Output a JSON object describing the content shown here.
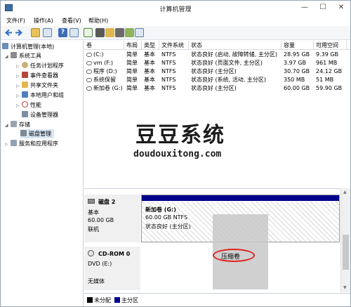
{
  "window": {
    "title": "计算机管理",
    "minimize": "—",
    "maximize": "☐",
    "close": "✕"
  },
  "menu": [
    "文件(F)",
    "操作(A)",
    "查看(V)",
    "帮助(H)"
  ],
  "tree": {
    "root": "计算机管理(本地)",
    "system_tools": "系统工具",
    "task_scheduler": "任务计划程序",
    "event_viewer": "事件查看器",
    "shared_folders": "共享文件夹",
    "local_users": "本地用户和组",
    "performance": "性能",
    "device_manager": "设备管理器",
    "storage": "存储",
    "disk_management": "磁盘管理",
    "services": "服务和应用程序"
  },
  "volumes": {
    "headers": [
      "卷",
      "布局",
      "类型",
      "文件系统",
      "状态",
      "容量",
      "可用空间"
    ],
    "rows": [
      [
        "(C:)",
        "简单",
        "基本",
        "NTFS",
        "状态良好 (启动, 故障转储, 主分区)",
        "28.95 GB",
        "9.39 GB"
      ],
      [
        "vm (F:)",
        "简单",
        "基本",
        "NTFS",
        "状态良好 (页面文件, 主分区)",
        "3.97 GB",
        "961 MB"
      ],
      [
        "程序 (D:)",
        "简单",
        "基本",
        "NTFS",
        "状态良好 (主分区)",
        "30.70 GB",
        "24.12 GB"
      ],
      [
        "系统保留",
        "简单",
        "基本",
        "NTFS",
        "状态良好 (系统, 活动, 主分区)",
        "350 MB",
        "51 MB"
      ],
      [
        "新加卷 (G:)",
        "简单",
        "基本",
        "NTFS",
        "状态良好 (主分区)",
        "60.00 GB",
        "59.90 GB"
      ]
    ]
  },
  "watermark": {
    "title": "豆豆系统",
    "url": "doudouxitong.com"
  },
  "disk2": {
    "name": "磁盘 2",
    "type": "基本",
    "size": "60.00 GB",
    "status": "联机"
  },
  "partition": {
    "name": "新加卷 (G:)",
    "size": "60.00 GB NTFS",
    "status": "状态良好 (主分区)"
  },
  "cdrom": {
    "name": "CD-ROM 0",
    "drive": "DVD (E:)",
    "media": "无媒体"
  },
  "context_menu": {
    "item": "压缩卷"
  },
  "legend": {
    "unallocated": "未分配",
    "primary": "主分区"
  },
  "colors": {
    "primary_bar": "#00008b",
    "unallocated": "#000000",
    "highlight_ring": "#e02020"
  }
}
